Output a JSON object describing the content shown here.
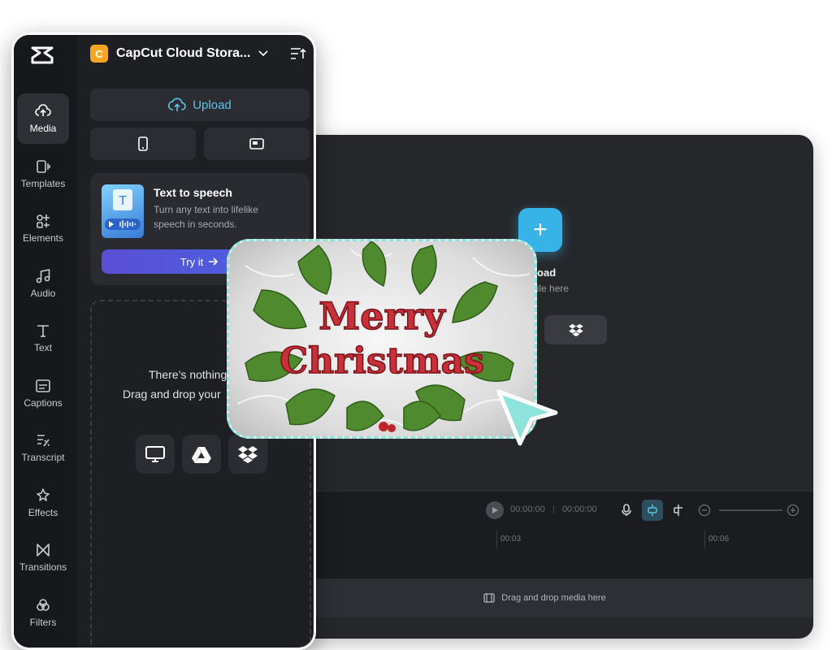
{
  "editor": {
    "upload_title": "o upload",
    "upload_sub": "drop file here",
    "time_current": "00:00:00",
    "time_total": "00:00:00",
    "ruler_marks": [
      "00:03",
      "00:06"
    ],
    "drop_media_text": "Drag and drop media here"
  },
  "sidebar": {
    "items": [
      {
        "label": "Media",
        "icon": "media-icon"
      },
      {
        "label": "Templates",
        "icon": "templates-icon"
      },
      {
        "label": "Elements",
        "icon": "elements-icon"
      },
      {
        "label": "Audio",
        "icon": "audio-icon"
      },
      {
        "label": "Text",
        "icon": "text-icon"
      },
      {
        "label": "Captions",
        "icon": "captions-icon"
      },
      {
        "label": "Transcript",
        "icon": "transcript-icon"
      },
      {
        "label": "Effects",
        "icon": "effects-icon"
      },
      {
        "label": "Transitions",
        "icon": "transitions-icon"
      },
      {
        "label": "Filters",
        "icon": "filters-icon"
      }
    ]
  },
  "panel": {
    "storage_badge": "C",
    "storage_title": "CapCut Cloud Stora...",
    "upload_label": "Upload",
    "tts": {
      "title": "Text to speech",
      "description": "Turn any text into lifelike speech in seconds.",
      "button": "Try it"
    },
    "empty_line1": "There’s nothing",
    "empty_line2": "Drag and drop your"
  },
  "drag_card": {
    "image_text_line1": "Merry",
    "image_text_line2": "Christmas"
  },
  "colors": {
    "accent": "#38b3e8",
    "badge": "#f5a623",
    "tts_button": "#5a4fd6",
    "drag_border": "#8ee3dc"
  }
}
